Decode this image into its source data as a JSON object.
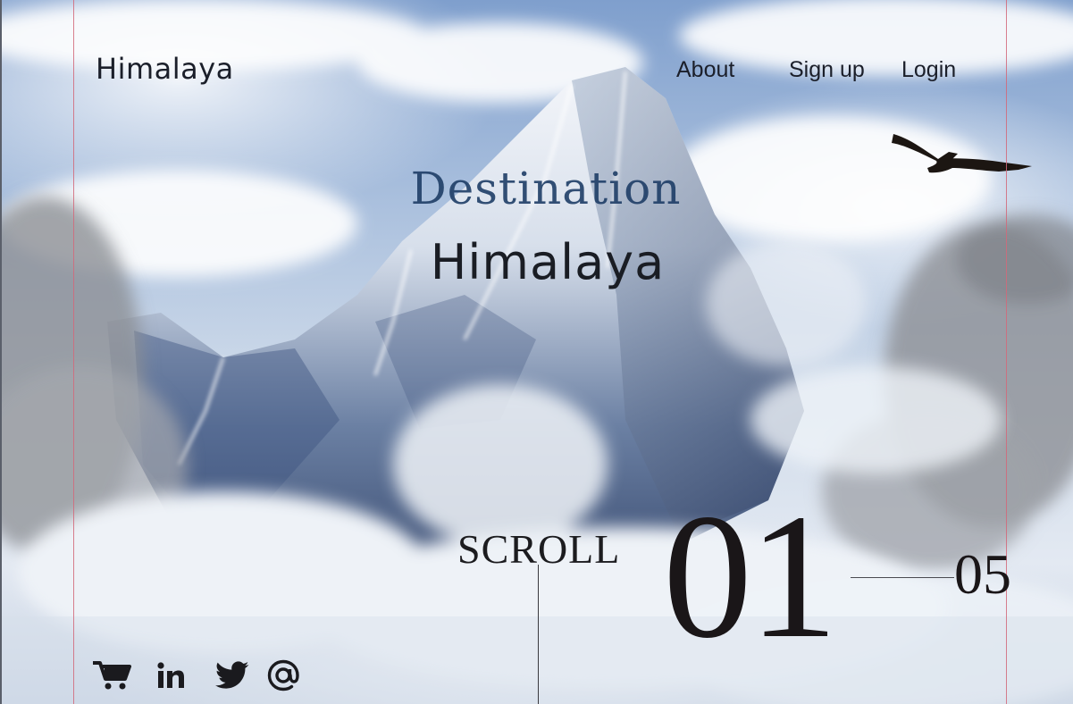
{
  "header": {
    "brand": "Himalaya",
    "nav": [
      {
        "label": "About"
      },
      {
        "label": "Sign up"
      },
      {
        "label": "Login"
      }
    ]
  },
  "hero": {
    "eyebrow": "Destination",
    "title": "Himalaya"
  },
  "scroll": {
    "label": "SCROLL"
  },
  "slide_counter": {
    "current": "01",
    "total": "05"
  },
  "social": [
    {
      "icon": "cart-icon"
    },
    {
      "icon": "linkedin-icon"
    },
    {
      "icon": "twitter-icon"
    },
    {
      "icon": "at-sign-icon"
    }
  ],
  "colors": {
    "text_dark": "#1b1f2a",
    "accent_blue": "#1f3e66",
    "guide_line": "#d2687a"
  }
}
